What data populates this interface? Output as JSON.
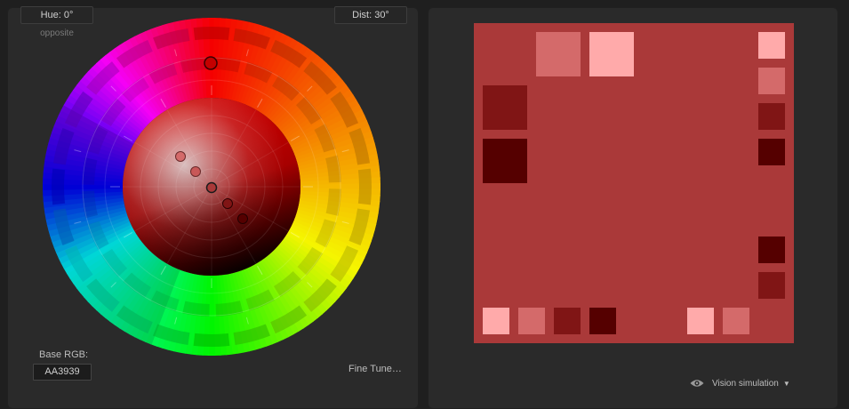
{
  "header": {
    "hue_field": "Hue: 0°",
    "dist_field": "Dist: 30°",
    "mode_label": "opposite"
  },
  "wheel": {
    "hue_deg": 0,
    "distance_deg": 30,
    "mode": "opposite"
  },
  "base_rgb": {
    "label": "Base RGB:",
    "value": "AA3939"
  },
  "fine_tune_label": "Fine Tune…",
  "preview": {
    "background": "#AA3939",
    "colors": {
      "base": "#AA3939",
      "light": "#D46A6A",
      "lightest": "#FFAAAA",
      "dark": "#801515",
      "darkest": "#550000"
    }
  },
  "vision_simulation": {
    "label": "Vision simulation",
    "icon": "eye-icon",
    "caret": "▼"
  }
}
